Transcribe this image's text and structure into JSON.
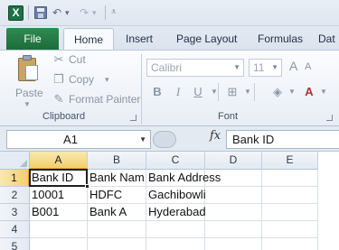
{
  "app": {
    "logo_letter": "X"
  },
  "quick_access": {
    "undo_glyph": "↶",
    "redo_glyph": "↷",
    "dropdown_glyph": "▾",
    "customize_glyph": "⩡"
  },
  "tabs": {
    "file": "File",
    "items": [
      "Home",
      "Insert",
      "Page Layout",
      "Formulas",
      "Dat"
    ],
    "active": "Home"
  },
  "ribbon": {
    "clipboard": {
      "paste": "Paste",
      "cut": "Cut",
      "copy": "Copy",
      "copy_caret": "▾",
      "format_painter": "Format Painter",
      "group_label": "Clipboard"
    },
    "font": {
      "font_name": "Calibri",
      "font_size": "11",
      "grow": "A",
      "shrink": "A",
      "bold": "B",
      "italic": "I",
      "underline": "U",
      "group_label": "Font"
    }
  },
  "formula_bar": {
    "name_box": "A1",
    "fx": "fx",
    "content": "Bank ID"
  },
  "sheet": {
    "columns": [
      "A",
      "B",
      "C",
      "D",
      "E"
    ],
    "rows": [
      "1",
      "2",
      "3",
      "4",
      "5"
    ],
    "cells": [
      [
        "Bank ID",
        "Bank Nam",
        "Bank Address",
        "",
        ""
      ],
      [
        "10001",
        "HDFC",
        "Gachibowli",
        "",
        ""
      ],
      [
        "B001",
        "Bank A",
        "Hyderabad",
        "",
        ""
      ],
      [
        "",
        "",
        "",
        "",
        ""
      ],
      [
        "",
        "",
        "",
        "",
        ""
      ]
    ],
    "selected_cell": "A1"
  }
}
